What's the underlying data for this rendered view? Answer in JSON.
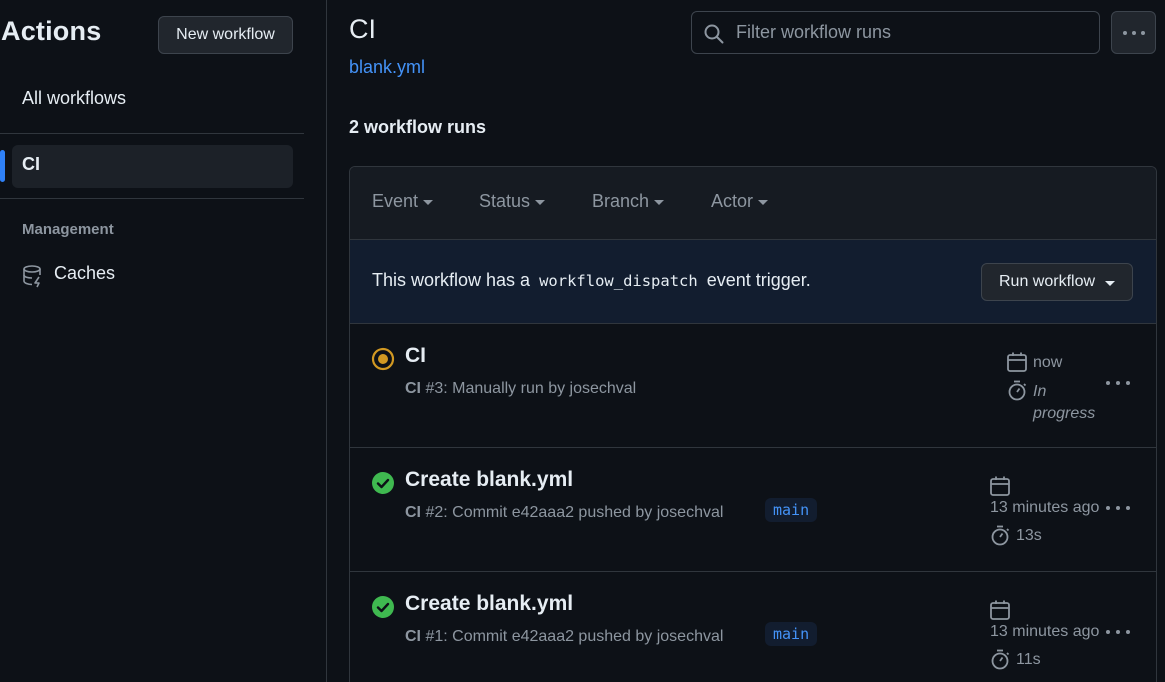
{
  "sidebar": {
    "title": "Actions",
    "new_workflow": "New workflow",
    "all_workflows": "All workflows",
    "workflows": [
      {
        "label": "CI",
        "selected": true
      }
    ],
    "management_heading": "Management",
    "caches": "Caches"
  },
  "header": {
    "title": "CI",
    "file": "blank.yml",
    "search_placeholder": "Filter workflow runs"
  },
  "runs_count": "2 workflow runs",
  "filters": [
    "Event",
    "Status",
    "Branch",
    "Actor"
  ],
  "dispatch": {
    "before": "This workflow has a",
    "code": "workflow_dispatch",
    "after": "event trigger.",
    "button": "Run workflow"
  },
  "runs": [
    {
      "status": "in-progress",
      "title": "CI",
      "workflow": "CI",
      "run_line": "#3: Manually run by josechval",
      "branch": "",
      "time": "now",
      "duration": "In progress"
    },
    {
      "status": "success",
      "title": "Create blank.yml",
      "workflow": "CI",
      "run_line": "#2: Commit e42aaa2 pushed by josechval",
      "branch": "main",
      "time": "13 minutes ago",
      "duration": "13s"
    },
    {
      "status": "success",
      "title": "Create blank.yml",
      "workflow": "CI",
      "run_line": "#1: Commit e42aaa2 pushed by josechval",
      "branch": "main",
      "time": "13 minutes ago",
      "duration": "11s"
    }
  ],
  "colors": {
    "accent": "#2f81f7",
    "link": "#4493f8",
    "success": "#3fb950",
    "in_progress": "#d29922"
  }
}
